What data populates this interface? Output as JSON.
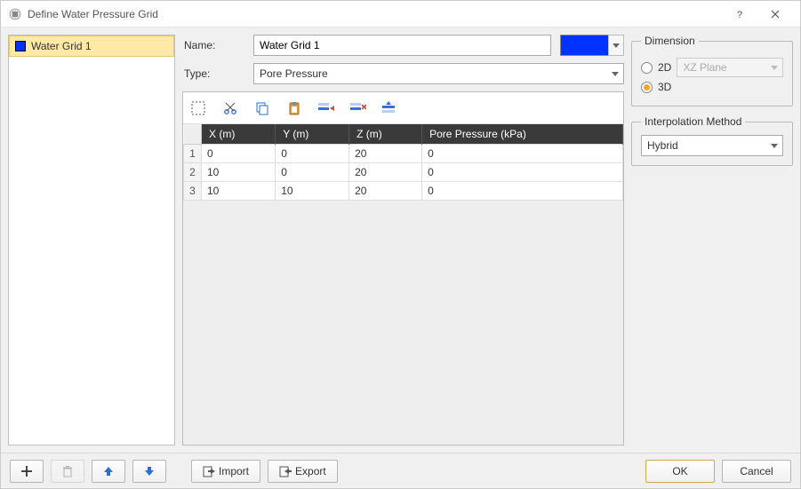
{
  "window": {
    "title": "Define Water Pressure Grid"
  },
  "sidebar": {
    "items": [
      {
        "label": "Water Grid 1",
        "color": "#0033ff"
      }
    ]
  },
  "form": {
    "name_label": "Name:",
    "name_value": "Water Grid 1",
    "type_label": "Type:",
    "type_value": "Pore Pressure",
    "swatch_color": "#0033ff"
  },
  "toolbar": {
    "select_all": "select-all",
    "cut": "cut",
    "copy": "copy",
    "paste": "paste",
    "insert_before": "insert-row-before",
    "insert_after": "delete-row",
    "delete_row": "insert-row-after"
  },
  "table": {
    "columns": [
      "X (m)",
      "Y (m)",
      "Z (m)",
      "Pore Pressure (kPa)"
    ],
    "rows": [
      {
        "n": "1",
        "x": "0",
        "y": "0",
        "z": "20",
        "p": "0"
      },
      {
        "n": "2",
        "x": "10",
        "y": "0",
        "z": "20",
        "p": "0"
      },
      {
        "n": "3",
        "x": "10",
        "y": "10",
        "z": "20",
        "p": "0"
      }
    ]
  },
  "dimension": {
    "legend": "Dimension",
    "opt2d": "2D",
    "opt3d": "3D",
    "plane_value": "XZ Plane",
    "selected": "3D"
  },
  "interpolation": {
    "legend": "Interpolation Method",
    "value": "Hybrid"
  },
  "footer": {
    "import": "Import",
    "export": "Export",
    "ok": "OK",
    "cancel": "Cancel"
  }
}
